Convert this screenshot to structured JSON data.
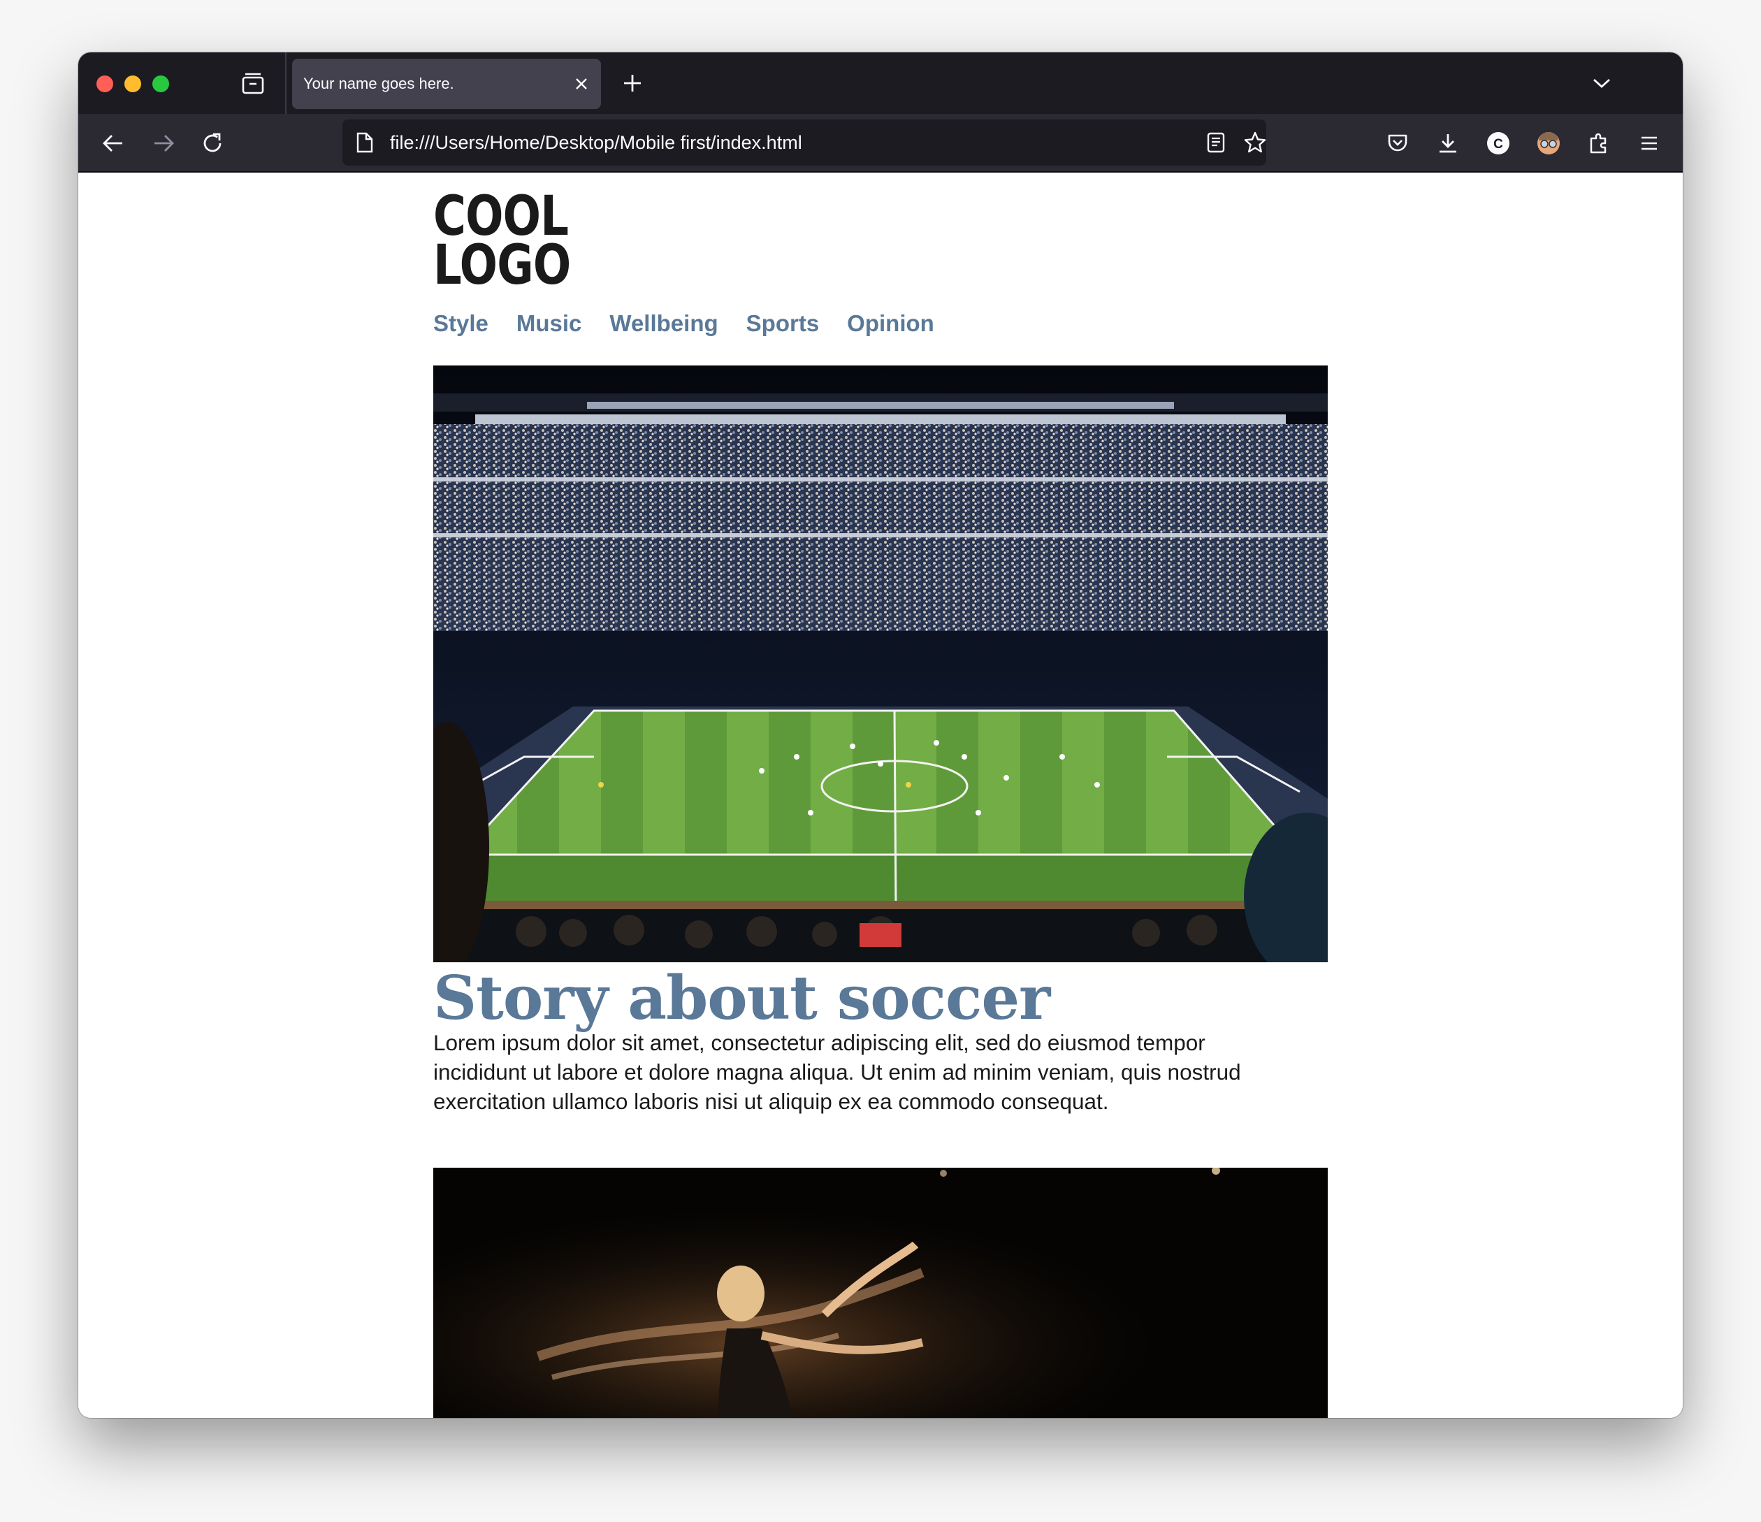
{
  "browser": {
    "tab_title": "Your name goes here.",
    "url": "file:///Users/Home/Desktop/Mobile first/index.html",
    "toolbar_extension_letter": "C"
  },
  "page": {
    "logo_line1": "COOL",
    "logo_line2": "LOGO",
    "nav": [
      "Style",
      "Music",
      "Wellbeing",
      "Sports",
      "Opinion"
    ],
    "story": {
      "title": "Story about soccer",
      "body": "Lorem ipsum dolor sit amet, consectetur adipiscing elit, sed do eiusmod tempor incididunt ut labore et dolore magna aliqua. Ut enim ad minim veniam, quis nostrud exercitation ullamco laboris nisi ut aliquip ex ea commodo consequat."
    }
  },
  "colors": {
    "accent": "#5a7897",
    "chrome_dark": "#1c1b22",
    "toolbar": "#2b2a33"
  },
  "icons": [
    "tab-overview-icon",
    "close-icon",
    "plus-icon",
    "chevron-down-icon",
    "back-arrow-icon",
    "forward-arrow-icon",
    "reload-icon",
    "page-icon",
    "reader-view-icon",
    "star-icon",
    "pocket-icon",
    "download-icon",
    "account-icon",
    "avatar-icon",
    "extensions-icon",
    "menu-icon"
  ]
}
